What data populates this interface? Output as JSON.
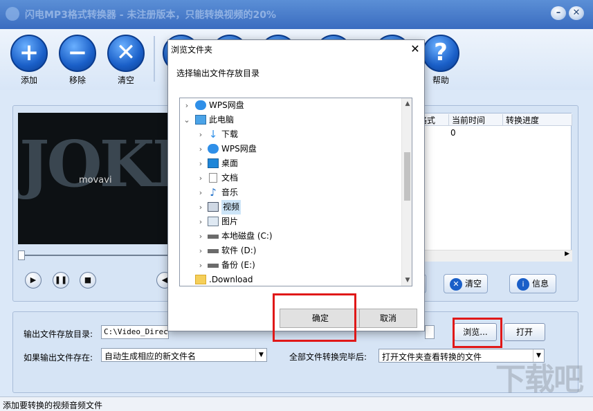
{
  "app": {
    "title": "闪电MP3格式转换器 - 未注册版本，只能转换视频的20%"
  },
  "toolbar": {
    "add": "添加",
    "remove": "移除",
    "clear": "清空",
    "help": "帮助"
  },
  "filelist": {
    "headers": [
      "格式",
      "当前时间",
      "转换进度"
    ],
    "row0_time": "0"
  },
  "video": {
    "bigtext": "JOKE",
    "brand": "movavi"
  },
  "side_buttons": {
    "clear": "清空",
    "info": "信息"
  },
  "output": {
    "dir_label": "输出文件存放目录:",
    "dir_value": "C:\\Video_Directo",
    "browse": "浏览...",
    "open": "打开",
    "exists_label": "如果输出文件存在:",
    "exists_value": "自动生成相应的新文件名",
    "done_label": "全部文件转换完毕后:",
    "done_value": "打开文件夹查看转换的文件"
  },
  "status": "添加要转换的视频音频文件",
  "dialog": {
    "title": "浏览文件夹",
    "prompt": "选择输出文件存放目录",
    "ok": "确定",
    "cancel": "取消",
    "tree": [
      {
        "label": "WPS网盘",
        "icon": "cloud-icon"
      },
      {
        "label": "此电脑",
        "icon": "computer-icon"
      },
      {
        "label": "下载",
        "icon": "download-icon"
      },
      {
        "label": "WPS网盘",
        "icon": "cloud-icon"
      },
      {
        "label": "桌面",
        "icon": "desktop-icon"
      },
      {
        "label": "文档",
        "icon": "document-icon"
      },
      {
        "label": "音乐",
        "icon": "music-icon"
      },
      {
        "label": "视频",
        "icon": "video-icon"
      },
      {
        "label": "图片",
        "icon": "picture-icon"
      },
      {
        "label": "本地磁盘 (C:)",
        "icon": "drive-icon"
      },
      {
        "label": "软件 (D:)",
        "icon": "drive-icon"
      },
      {
        "label": "备份 (E:)",
        "icon": "drive-icon"
      },
      {
        "label": ".Download",
        "icon": "folder-icon"
      }
    ]
  },
  "watermark": "下载吧",
  "colors": {
    "accent": "#1a5fc8",
    "highlight": "#e01818",
    "selection": "#cce4f7"
  }
}
